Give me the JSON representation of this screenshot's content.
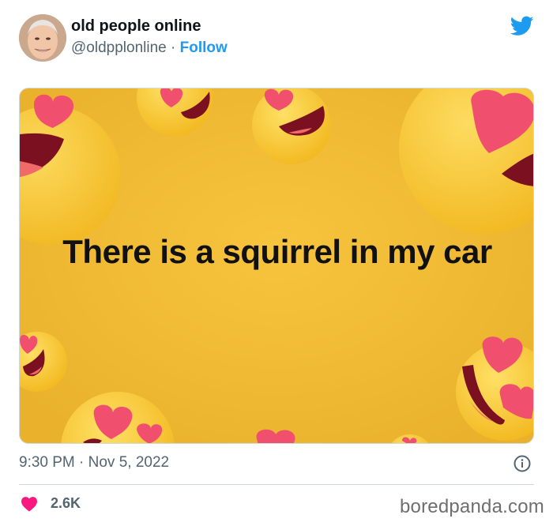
{
  "header": {
    "display_name": "old people online",
    "handle": "@oldpplonline",
    "separator": "·",
    "follow_label": "Follow"
  },
  "image": {
    "caption": "There is a squirrel in my car"
  },
  "footer": {
    "timestamp": "9:30 PM · Nov 5, 2022",
    "like_count": "2.6K",
    "watermark": "boredpanda.com"
  },
  "icons": {
    "brand": "twitter-bird-icon",
    "info": "info-icon",
    "like": "heart-icon"
  },
  "colors": {
    "accent": "#1d9bf0",
    "like": "#f91880",
    "image_background": "#f0bd36"
  }
}
